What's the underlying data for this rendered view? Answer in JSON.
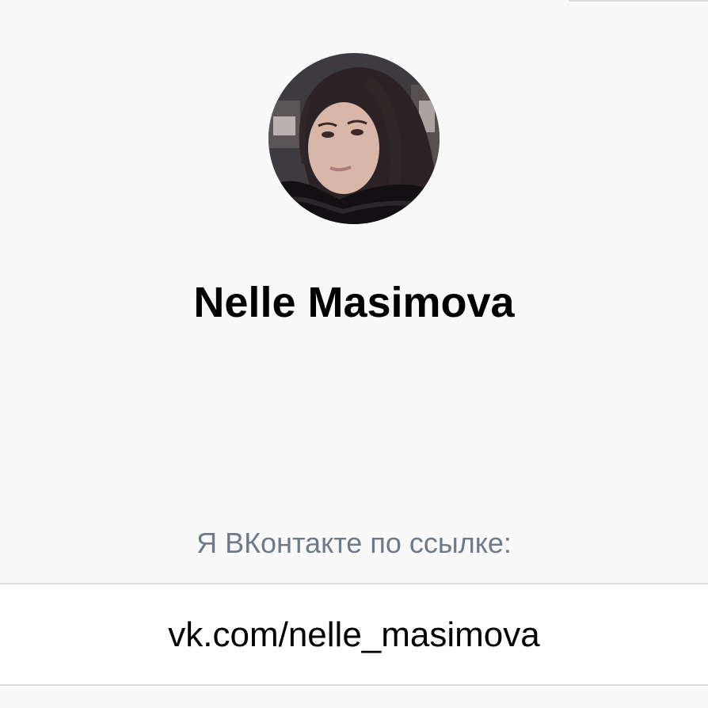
{
  "profile": {
    "avatar_icon": "profile-photo",
    "name": "Nelle Masimova"
  },
  "share": {
    "caption": "Я ВКонтакте по ссылке:",
    "link": "vk.com/nelle_masimova"
  },
  "colors": {
    "background": "#f9f9fa",
    "caption": "#6e7a88",
    "divider": "#dcdde0",
    "text": "#000000"
  }
}
